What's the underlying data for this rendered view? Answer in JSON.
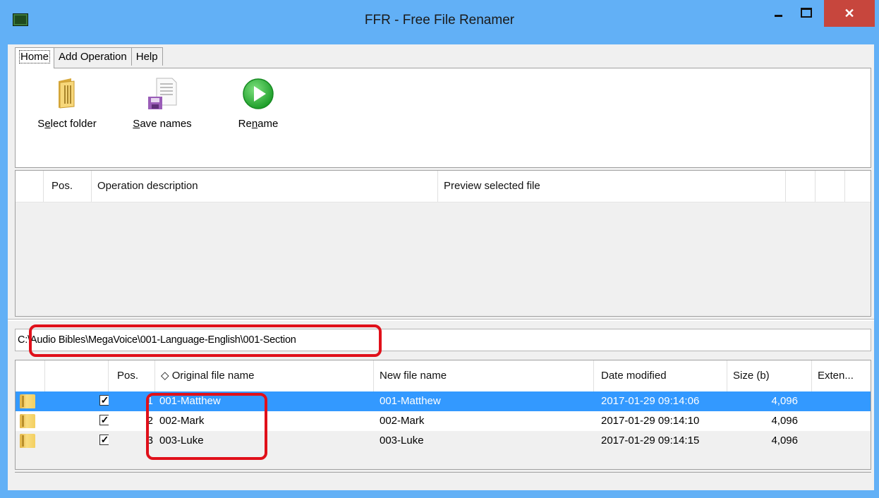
{
  "window": {
    "title": "FFR - Free File Renamer",
    "close_label": "✕"
  },
  "tabs": [
    {
      "label": "Home",
      "active": true
    },
    {
      "label": "Add Operation",
      "active": false
    },
    {
      "label": "Help",
      "active": false
    }
  ],
  "ribbon": {
    "select_folder": {
      "pre": "S",
      "u": "e",
      "post": "lect folder",
      "icon": "folder-icon"
    },
    "save_names": {
      "pre": "",
      "u": "S",
      "post": "ave names",
      "icon": "save-icon"
    },
    "rename": {
      "pre": "Re",
      "u": "n",
      "post": "ame",
      "icon": "play-icon"
    }
  },
  "operations": {
    "headers": [
      "",
      "Pos.",
      "Operation description",
      "Preview selected file",
      "",
      "",
      ""
    ]
  },
  "path": "C:\\Audio Bibles\\MegaVoice\\001-Language-English\\001-Section",
  "files": {
    "headers": [
      "",
      "",
      "Pos.",
      "◇ Original file name",
      "New file name",
      "Date modified",
      "Size (b)",
      "Exten..."
    ],
    "rows": [
      {
        "checked": true,
        "pos": "1",
        "original": "001-Matthew",
        "new": "001-Matthew",
        "date": "2017-01-29 09:14:06",
        "size": "4,096",
        "ext": "",
        "selected": true
      },
      {
        "checked": true,
        "pos": "2",
        "original": "002-Mark",
        "new": "002-Mark",
        "date": "2017-01-29 09:14:10",
        "size": "4,096",
        "ext": "",
        "selected": false
      },
      {
        "checked": true,
        "pos": "3",
        "original": "003-Luke",
        "new": "003-Luke",
        "date": "2017-01-29 09:14:15",
        "size": "4,096",
        "ext": "",
        "selected": false
      }
    ]
  },
  "colors": {
    "titlebar": "#62b0f6",
    "close_button": "#c7463d",
    "selection": "#3399ff",
    "annotation": "#e0101a"
  }
}
